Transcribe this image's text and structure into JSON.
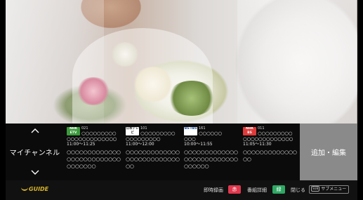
{
  "mychannel": {
    "label": "マイチャンネル"
  },
  "cards": [
    {
      "logo_text": "NHK ETV",
      "logo_bg": "#3c9a3c",
      "logo_fg": "#ffffff",
      "ch_num": "021",
      "ch_name": "○○○○○○○○○",
      "line1": "○○○○○○○○○○○○○",
      "time": "11:00～11:25",
      "desc": "○○○○○○○○○○○○○○○○○○○○○○○○○○○○○○○○○"
    },
    {
      "logo_text": "日本テレビ",
      "logo_bg": "#ffffff",
      "logo_fg": "#333333",
      "ch_num": "101",
      "ch_name": "○○○○○○○○○",
      "line1": "○○○○○○○○○",
      "time": "11:00～12:00",
      "desc": "○○○○○○○○○○○○○○○○○○○○○○○○○○○○"
    },
    {
      "logo_text": "BS-TBS",
      "logo_bg": "#ffffff",
      "logo_fg": "#1a4fa0",
      "ch_num": "161",
      "ch_name": "○○○○○○",
      "line1": "○○○",
      "time": "10:00～11:55",
      "desc": "○○○○○○○○○○○○○○○○○○○○○○○○○○○○○○○○"
    },
    {
      "logo_text": "NHK BS",
      "logo_bg": "#e03a3a",
      "logo_fg": "#ffffff",
      "ch_num": "011",
      "ch_name": "○○○○○○○○○",
      "line1": "○○○○○○○○○○○○○",
      "time": "11:05～11:30",
      "desc": "○○○○○○○○○○○○○○○"
    }
  ],
  "edit_button": {
    "label": "追加・編集"
  },
  "footer": {
    "logo": "GUIDE",
    "instant_record": "即時録画",
    "red_key": "赤",
    "program_detail": "番組詳細",
    "green_key": "緑",
    "close": "閉じる",
    "submenu_icon": "SUB",
    "submenu": "サブメニュー"
  },
  "colors": {
    "panel_bg": "#0b0b0b",
    "edit_bg": "#8a8a8a",
    "red_key": "#e0384e",
    "green_key": "#2fa864",
    "logo_gold": "#d4b228"
  }
}
